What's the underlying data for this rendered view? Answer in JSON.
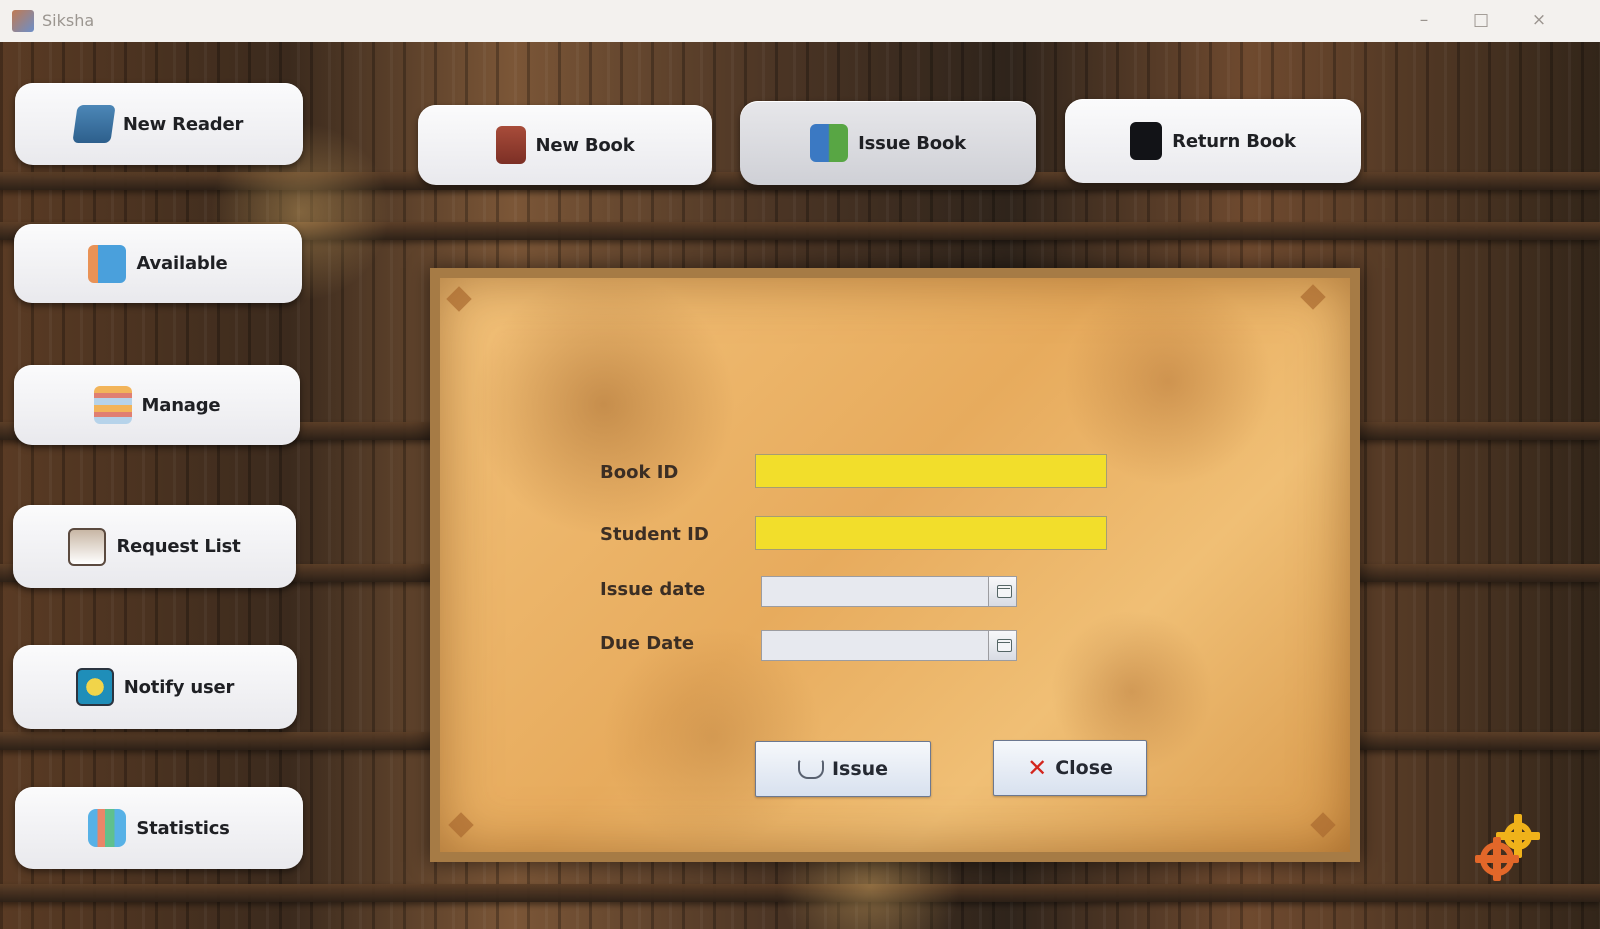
{
  "window": {
    "title": "Siksha",
    "controls": {
      "minimize": "–",
      "maximize": "□",
      "close": "×"
    }
  },
  "sidebar": {
    "items": [
      {
        "label": "New Reader",
        "icon": "reader-icon"
      },
      {
        "label": "Available",
        "icon": "books-icon"
      },
      {
        "label": "Manage",
        "icon": "manage-icon"
      },
      {
        "label": "Request List",
        "icon": "clipboard-icon"
      },
      {
        "label": "Notify user",
        "icon": "bell-icon"
      },
      {
        "label": "Statistics",
        "icon": "chart-icon"
      }
    ]
  },
  "top_actions": {
    "items": [
      {
        "label": "New Book",
        "icon": "book-plus-icon"
      },
      {
        "label": "Issue Book",
        "icon": "open-book-icon"
      },
      {
        "label": "Return Book",
        "icon": "return-book-icon"
      }
    ]
  },
  "form": {
    "book_id_label": "Book ID",
    "book_id_value": "",
    "student_id_label": "Student ID",
    "student_id_value": "",
    "issue_date_label": "Issue date",
    "issue_date_value": "",
    "due_date_label": "Due Date",
    "due_date_value": ""
  },
  "actions": {
    "issue_label": "Issue",
    "close_label": "Close"
  },
  "colors": {
    "input_highlight": "#f2de2b",
    "panel": "#e9b064",
    "button": "#f4f4f6"
  }
}
